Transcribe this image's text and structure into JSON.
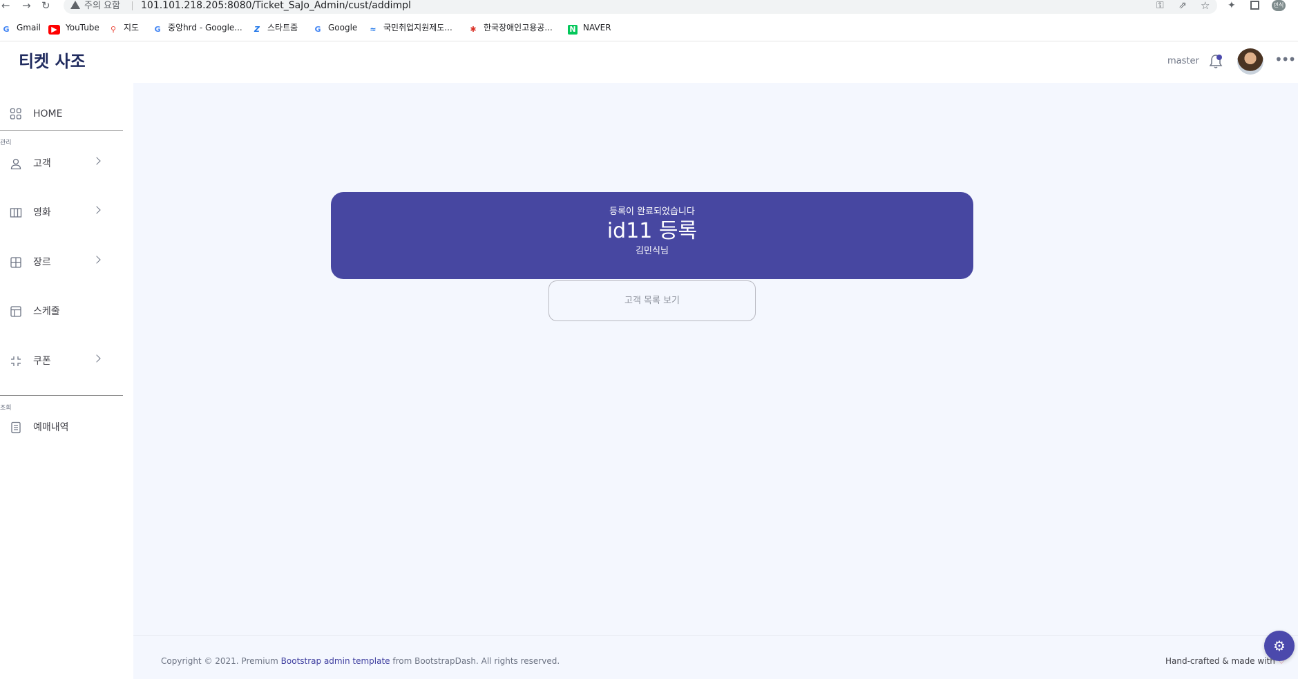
{
  "browser": {
    "warning": "주의 요함",
    "url": "101.101.218.205:8080/Ticket_SaJo_Admin/cust/addimpl",
    "profile_initials": "민식"
  },
  "bookmarks": [
    {
      "label": "Gmail",
      "icon": "google-icon"
    },
    {
      "label": "YouTube",
      "icon": "youtube-icon"
    },
    {
      "label": "지도",
      "icon": "maps-pin-icon"
    },
    {
      "label": "중앙hrd - Google...",
      "icon": "google-icon"
    },
    {
      "label": "스타트줌",
      "icon": "z-logo-icon"
    },
    {
      "label": "Google",
      "icon": "google-icon"
    },
    {
      "label": "국민취업지원제도...",
      "icon": "worknet-icon"
    },
    {
      "label": "한국장애인고용공...",
      "icon": "kead-icon"
    },
    {
      "label": "NAVER",
      "icon": "naver-icon"
    }
  ],
  "header": {
    "brand": "티켓 사조",
    "user": "master"
  },
  "sidebar": {
    "home": "HOME",
    "section_manage": "관리",
    "items": [
      {
        "label": "고객",
        "icon": "user-icon",
        "has_submenu": true
      },
      {
        "label": "영화",
        "icon": "columns-icon",
        "has_submenu": true
      },
      {
        "label": "장르",
        "icon": "grid-icon",
        "has_submenu": true
      },
      {
        "label": "스케줄",
        "icon": "layout-icon",
        "has_submenu": false
      },
      {
        "label": "쿠폰",
        "icon": "shrink-icon",
        "has_submenu": true
      }
    ],
    "section_view": "조회",
    "view_items": [
      {
        "label": "예매내역",
        "icon": "document-icon"
      }
    ]
  },
  "main": {
    "banner": {
      "subtitle": "등록이 완료되었습니다",
      "title": "id11 등록",
      "name": "김민식님"
    },
    "list_button": "고객 목록 보기"
  },
  "footer": {
    "copyright_prefix": "Copyright © 2021. Premium ",
    "link": "Bootstrap admin template",
    "copyright_suffix": " from BootstrapDash. All rights reserved.",
    "right": "Hand-crafted & made with"
  },
  "colors": {
    "accent": "#4b49ac",
    "banner": "#4747a1",
    "main_bg": "#f4f7fe"
  }
}
